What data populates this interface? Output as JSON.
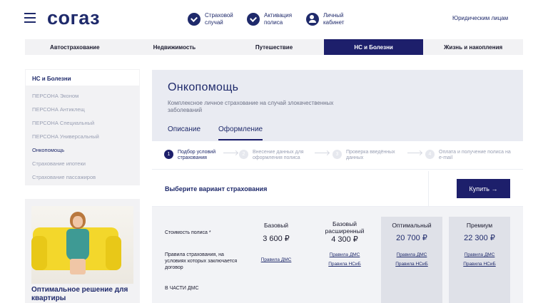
{
  "header": {
    "logo": "согаз",
    "links": [
      {
        "label": "Страховой случай",
        "icon": "check-circle-icon"
      },
      {
        "label": "Активация полиса",
        "icon": "check-circle-icon"
      },
      {
        "label": "Личный кабинет",
        "icon": "user-icon"
      }
    ],
    "corporate": "Юридическим лицам"
  },
  "main_nav": [
    {
      "label": "Автострахование",
      "active": false
    },
    {
      "label": "Недвижимость",
      "active": false
    },
    {
      "label": "Путешествие",
      "active": false
    },
    {
      "label": "НС и Болезни",
      "active": true
    },
    {
      "label": "Жизнь и накопления",
      "active": false
    }
  ],
  "sidebar": {
    "heading": "НС и Болезни",
    "items": [
      {
        "label": "ПЕРСОНА Эконом",
        "current": false
      },
      {
        "label": "ПЕРСОНА Антиклещ",
        "current": false
      },
      {
        "label": "ПЕРСОНА Специальный",
        "current": false
      },
      {
        "label": "ПЕРСОНА Универсальный",
        "current": false
      },
      {
        "label": "Онкопомощь",
        "current": true
      },
      {
        "label": "Страхование ипотеки",
        "current": false
      },
      {
        "label": "Страхование пассажиров",
        "current": false
      }
    ]
  },
  "promo": {
    "title": "Оптимальное решение для квартиры"
  },
  "product": {
    "title": "Онкопомощь",
    "subtitle": "Комплексное личное страхование на случай злокачественных заболеваний",
    "tabs": [
      {
        "label": "Описание",
        "active": false
      },
      {
        "label": "Оформление",
        "active": true
      }
    ]
  },
  "steps": [
    {
      "num": "1",
      "label": "Подбор условий страхования",
      "active": true
    },
    {
      "num": "2",
      "label": "Внесение данных для оформления полиса",
      "active": false
    },
    {
      "num": "3",
      "label": "Проверка введённых данных",
      "active": false
    },
    {
      "num": "4",
      "label": "Оплата и получение полиса на e-mail",
      "active": false
    }
  ],
  "choose": {
    "label": "Выберите вариант страхования",
    "buy_label": "Купить →"
  },
  "table": {
    "row_labels": {
      "cost": "Стоимость полиса *",
      "rules": "Правила страхования, на условиях которых заключается договор",
      "dms": "В ЧАСТИ ДМС"
    },
    "plans": [
      {
        "name": "Базовый",
        "price": "3 600 ₽",
        "links": [
          "Правила ДМС"
        ],
        "shaded": false
      },
      {
        "name": "Базовый расширенный",
        "price": "4 300 ₽",
        "links": [
          "Правила ДМС",
          "Правила НСиБ"
        ],
        "shaded": false
      },
      {
        "name": "Оптимальный",
        "price": "20 700 ₽",
        "links": [
          "Правила ДМС",
          "Правила НСиБ"
        ],
        "shaded": true
      },
      {
        "name": "Премиум",
        "price": "22 300 ₽",
        "links": [
          "Правила ДМС",
          "Правила НСиБ"
        ],
        "shaded": true
      }
    ]
  }
}
